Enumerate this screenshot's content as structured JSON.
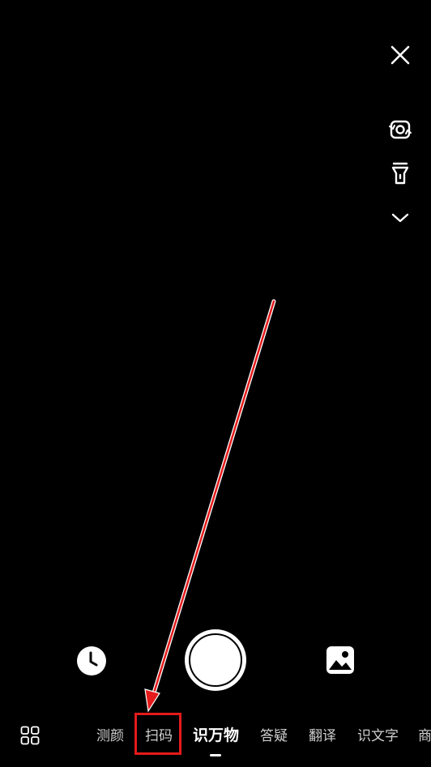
{
  "top_controls": {
    "close_icon": "close-icon",
    "flip_camera_icon": "camera-flip-icon",
    "flashlight_icon": "flashlight-icon",
    "expand_icon": "chevron-down-icon"
  },
  "bottom_controls": {
    "history_icon": "clock-icon",
    "shutter_icon": "shutter-button",
    "gallery_icon": "image-icon"
  },
  "mode_bar": {
    "grid_icon": "grid-icon",
    "tabs": [
      {
        "label": "测颜"
      },
      {
        "label": "扫码"
      },
      {
        "label": "识万物"
      },
      {
        "label": "答疑"
      },
      {
        "label": "翻译"
      },
      {
        "label": "识文字"
      },
      {
        "label": "商"
      }
    ],
    "active_tab_label": "识万物"
  },
  "annotation": {
    "color": "#e51a1a",
    "highlighted_tab_label": "扫码"
  },
  "colors": {
    "background": "#000000",
    "foreground": "#ffffff",
    "inactive_tab": "#cfcfcf",
    "annotation_red": "#e51a1a"
  }
}
